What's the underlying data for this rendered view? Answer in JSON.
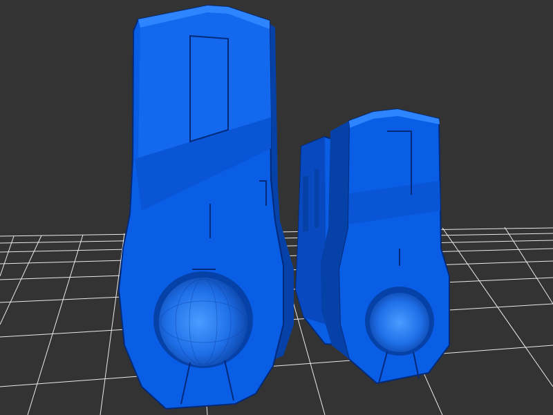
{
  "viewport": {
    "background": "#333333",
    "grid_color": "#ffffff"
  },
  "model": {
    "base_color": "#0a5ee6",
    "light_color": "#2f85ff",
    "dark_color": "#0641a8",
    "edge_color": "#032a78",
    "objects": [
      {
        "name": "large-part",
        "has_ball_socket": true
      },
      {
        "name": "small-part",
        "has_ball_socket": true
      },
      {
        "name": "rear-small-part",
        "has_ball_socket": false
      }
    ]
  }
}
